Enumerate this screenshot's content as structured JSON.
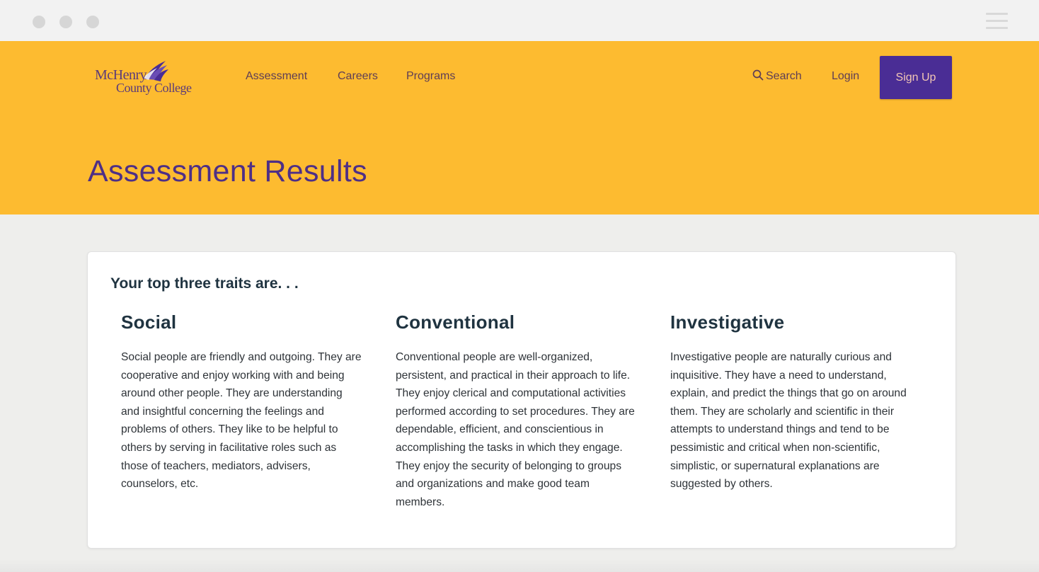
{
  "browser": {
    "window_controls": [
      "close",
      "minimize",
      "maximize"
    ],
    "menu_icon": "hamburger-menu-icon"
  },
  "header": {
    "logo": {
      "line1": "McHenry",
      "line2": "County College",
      "mark_icon": "feather-plume-icon"
    },
    "nav": [
      {
        "label": "Assessment"
      },
      {
        "label": "Careers"
      },
      {
        "label": "Programs"
      }
    ],
    "search_label": "Search",
    "search_icon": "magnifier-icon",
    "login_label": "Login",
    "signup_label": "Sign Up",
    "page_title": "Assessment Results"
  },
  "colors": {
    "hero_bg": "#fdbb30",
    "brand_purple": "#4a2d95",
    "title_purple": "#4e2f86",
    "nav_text": "#5e3d55",
    "heading_text": "#1f3340",
    "page_bg": "#eeeeec"
  },
  "results": {
    "heading": "Your top three traits are. . .",
    "traits": [
      {
        "name": "Social",
        "lines": [
          "Social people are friendly and outgoing. They are",
          "cooperative and enjoy working with and being",
          "around other people. They are understanding",
          "and insightful concerning the feelings and",
          "problems of others. They like to be helpful to",
          "others by serving in facilitative roles such as",
          "those of teachers, mediators, advisers,",
          "counselors, etc."
        ]
      },
      {
        "name": "Conventional",
        "lines": [
          "Conventional people are well-organized,",
          "persistent, and practical in their approach to life.",
          "They enjoy clerical and computational activities",
          "performed according to set procedures. They are",
          "dependable, efficient, and conscientious in",
          "accomplishing the tasks in which they engage.",
          "They enjoy the security of belonging to groups",
          "and organizations and make good team",
          "members."
        ]
      },
      {
        "name": "Investigative",
        "lines": [
          "Investigative people are naturally curious and",
          "inquisitive. They have a need to understand,",
          "explain, and predict the things that go on around",
          "them. They are scholarly and scientific in their",
          "attempts to understand things and tend to be",
          "pessimistic and critical when non-scientific,",
          "simplistic, or supernatural explanations are",
          "suggested by others."
        ]
      }
    ]
  }
}
